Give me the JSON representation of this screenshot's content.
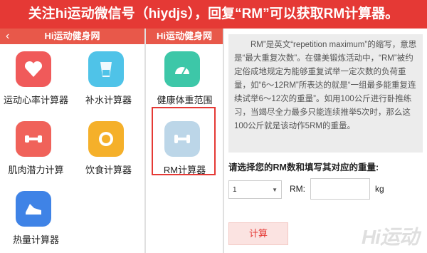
{
  "banner": {
    "text": "关注hi运动微信号（hiydjs），回复“RM”可以获取RM计算器。"
  },
  "nav": {
    "title": "Hi运动健身网",
    "back_icon": "chevron-left-icon"
  },
  "panel1": {
    "tiles": [
      {
        "label": "运动心率计算器",
        "icon": "heart-icon",
        "color": "#f05a5a"
      },
      {
        "label": "补水计算器",
        "icon": "water-cup-icon",
        "color": "#4fc3e8"
      },
      {
        "label": "肌肉潜力计算",
        "icon": "dumbbell-icon",
        "color": "#f0625a"
      },
      {
        "label": "饮食计算器",
        "icon": "plate-icon",
        "color": "#f5b02a"
      },
      {
        "label": "热量计算器",
        "icon": "shoe-icon",
        "color": "#3f83e6"
      }
    ]
  },
  "panel2": {
    "tiles": [
      {
        "label": "健康体重范围",
        "icon": "scale-icon",
        "color": "#3dc7a8"
      },
      {
        "label": "RM计算器",
        "icon": "barbell-icon",
        "color": "#bcd6e8"
      }
    ]
  },
  "rm": {
    "description": "RM”是英文“repetition maximum”的缩写，意思是“最大重复次数”。在健美锻炼活动中，“RM”被约定俗成地规定为能够重复试举一定次数的负荷重量，如“6～12RM”所表达的就是“一组最多能重复连续试举6～12次的重量”。如用100公斤进行卧推练习，当竭尽全力最多只能连续推举5次时，那么这100公斤就是该动作5RM的重量。",
    "prompt": "请选择您的RM数和填写其对应的重量:",
    "select_value": "1",
    "rm_label": "RM:",
    "weight_value": "",
    "unit": "kg",
    "calc_label": "计算"
  },
  "watermark": "Hi运动"
}
